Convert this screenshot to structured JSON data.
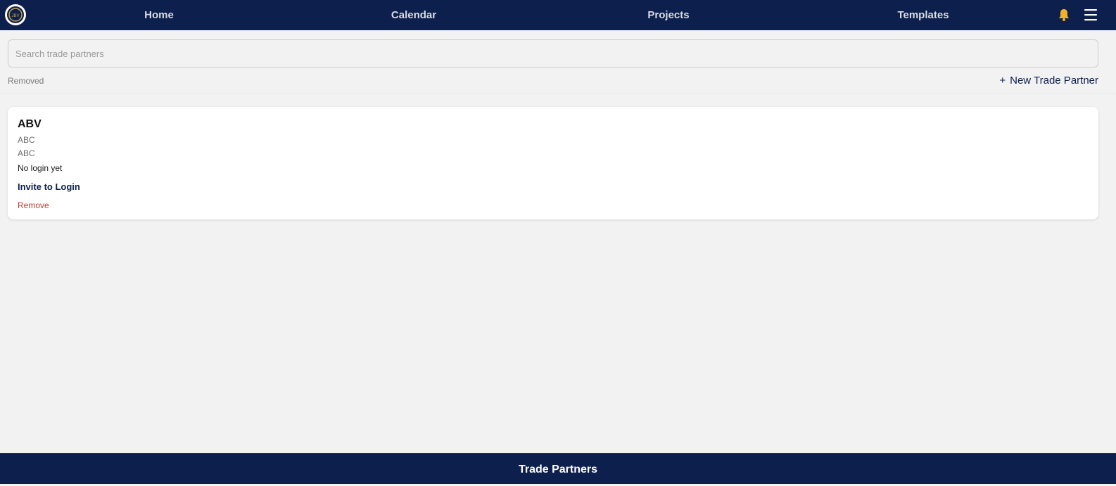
{
  "header": {
    "logo_text": "JBV",
    "nav": [
      {
        "label": "Home"
      },
      {
        "label": "Calendar"
      },
      {
        "label": "Projects"
      },
      {
        "label": "Templates"
      }
    ],
    "icons": {
      "notifications": "bell-icon",
      "menu": "hamburger-menu-icon"
    },
    "bell_color": "#f5b027"
  },
  "search": {
    "placeholder": "Search trade partners",
    "value": ""
  },
  "toolbar": {
    "removed_label": "Removed",
    "new_partner_plus": "+",
    "new_partner_label": "New Trade Partner"
  },
  "partners": [
    {
      "name": "ABV",
      "line1": "ABC",
      "line2": "ABC",
      "login_status": "No login yet",
      "invite_label": "Invite to Login",
      "remove_label": "Remove"
    }
  ],
  "footer": {
    "title": "Trade Partners"
  },
  "colors": {
    "navy": "#0d1f4c",
    "remove_red": "#c0392b",
    "background": "#f2f2f2"
  }
}
